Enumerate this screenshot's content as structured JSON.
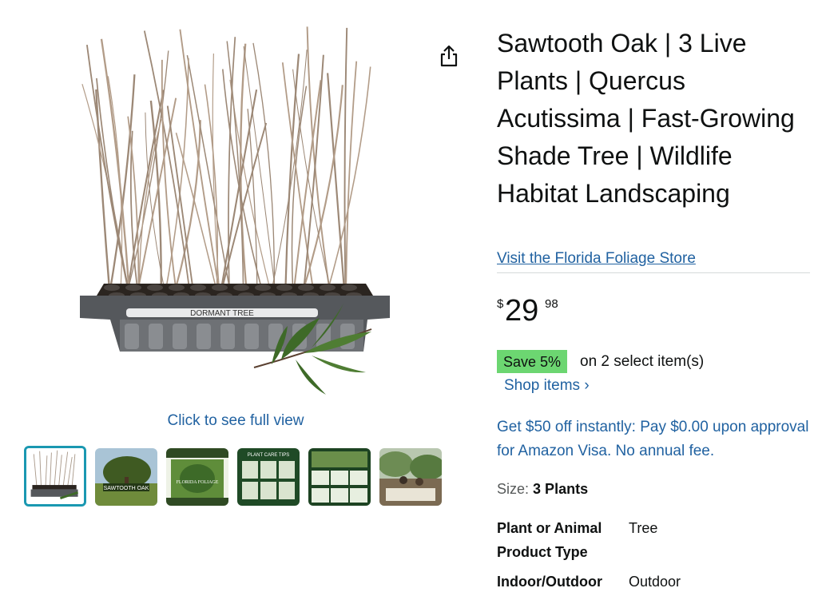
{
  "product": {
    "title": "Sawtooth Oak | 3 Live Plants | Quercus Acutissima | Fast-Growing Shade Tree | Wildlife Habitat Landscaping",
    "store_link": "Visit the Florida Foliage Store",
    "price": {
      "symbol": "$",
      "whole": "29",
      "fraction": "98"
    },
    "coupon": {
      "badge": "Save 5%",
      "text": "on 2 select item(s)",
      "link": "Shop items ›"
    },
    "promo": "Get $50 off instantly: Pay $0.00 upon approval for Amazon Visa. No annual fee.",
    "size": {
      "label": "Size:",
      "value": "3 Plants"
    },
    "specs": [
      {
        "key": "Plant or Animal Product Type",
        "value": "Tree"
      },
      {
        "key": "Indoor/Outdoor",
        "value": "Outdoor"
      }
    ]
  },
  "gallery": {
    "tray_label": "DORMANT TREE",
    "click_full_view": "Click to see full view",
    "thumbnails": [
      {
        "id": "tray",
        "selected": true
      },
      {
        "id": "sawtooth-oak-tree",
        "text": "SAWTOOTH OAK",
        "selected": false
      },
      {
        "id": "florida-foliage-brand",
        "text": "FLORIDA FOLIAGE",
        "selected": false
      },
      {
        "id": "plant-care-tips",
        "text": "PLANT CARE TIPS",
        "selected": false
      },
      {
        "id": "info-sheet",
        "selected": false
      },
      {
        "id": "garden-photo",
        "selected": false
      }
    ]
  },
  "colors": {
    "link": "#2162a1",
    "save_badge": "#6cd671",
    "thumb_selected_border": "#1a98b1",
    "text": "#0f1111"
  }
}
